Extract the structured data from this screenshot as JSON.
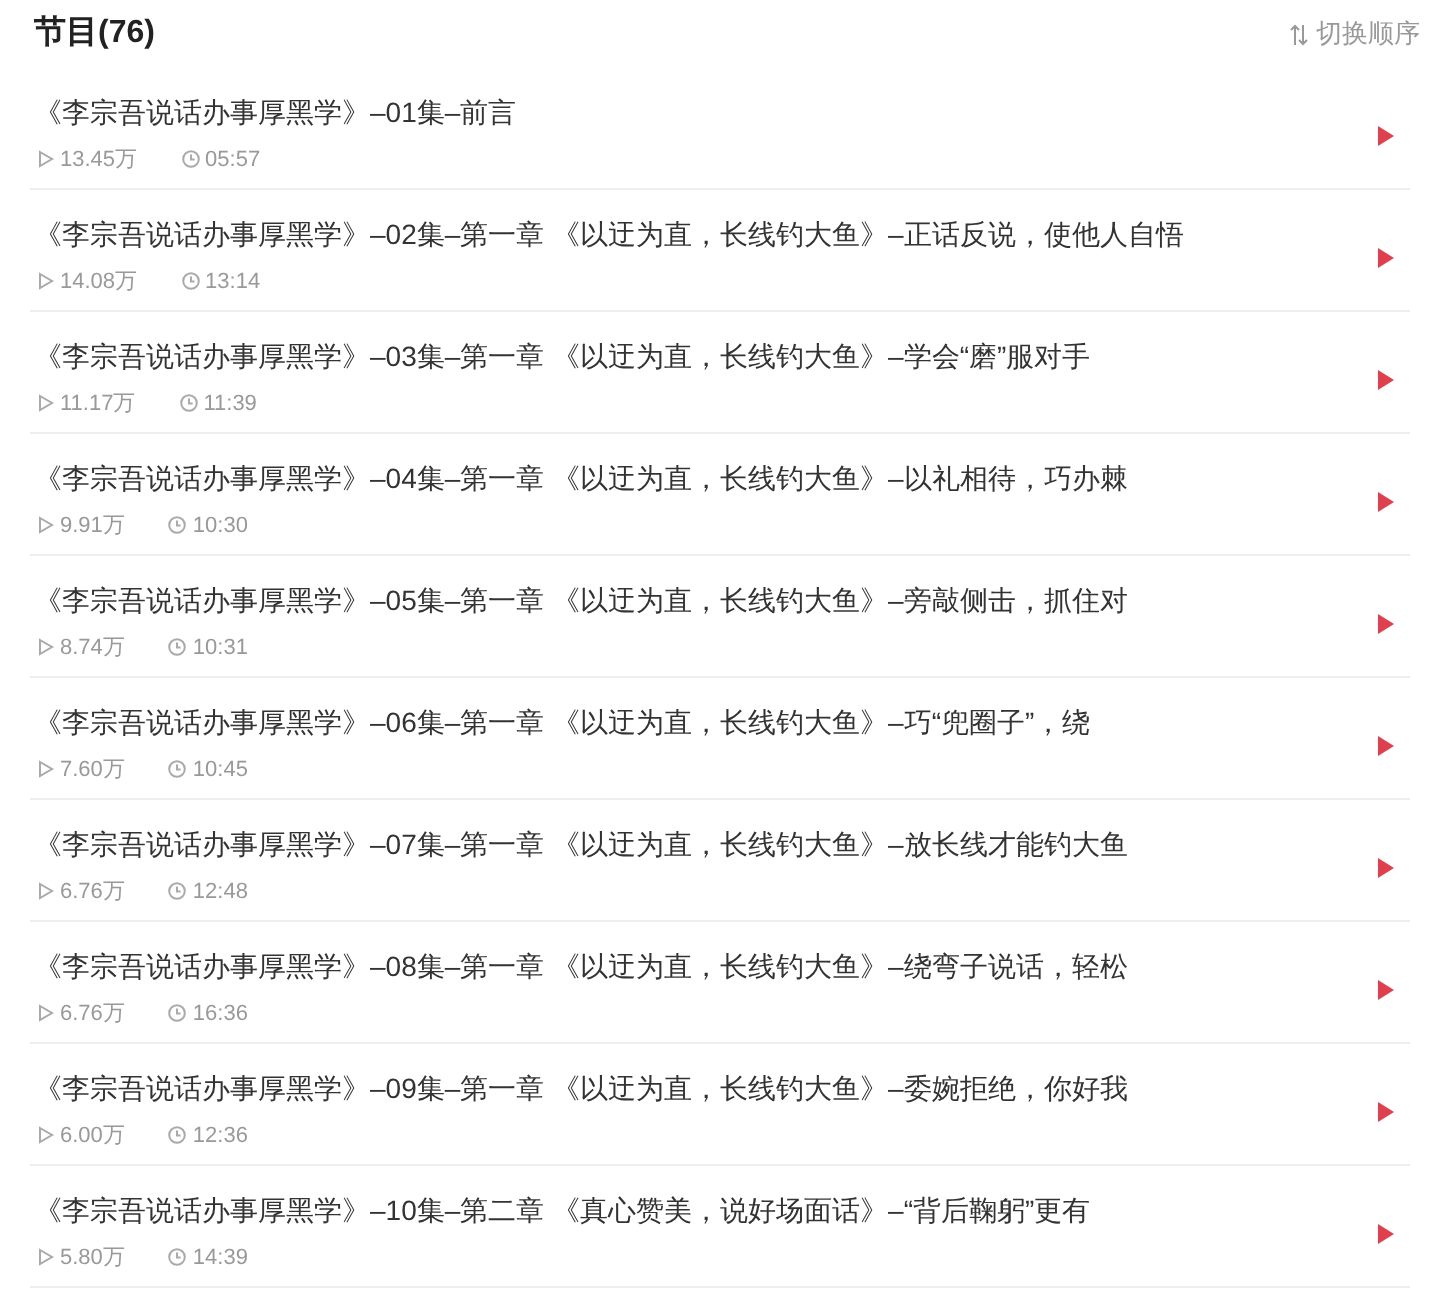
{
  "header": {
    "title": "节目(76)",
    "sort_label": "切换顺序"
  },
  "episodes": [
    {
      "title": "《李宗吾说话办事厚黑学》–01集–前言",
      "plays": "13.45万",
      "duration": "05:57"
    },
    {
      "title": "《李宗吾说话办事厚黑学》–02集–第一章 《以迂为直，长线钓大鱼》–正话反说，使他人自悟",
      "plays": "14.08万",
      "duration": "13:14"
    },
    {
      "title": "《李宗吾说话办事厚黑学》–03集–第一章 《以迂为直，长线钓大鱼》–学会“磨”服对手",
      "plays": "11.17万",
      "duration": "11:39"
    },
    {
      "title": "《李宗吾说话办事厚黑学》–04集–第一章 《以迂为直，长线钓大鱼》–以礼相待，巧办棘",
      "plays": "9.91万",
      "duration": "10:30"
    },
    {
      "title": "《李宗吾说话办事厚黑学》–05集–第一章 《以迂为直，长线钓大鱼》–旁敲侧击，抓住对",
      "plays": "8.74万",
      "duration": "10:31"
    },
    {
      "title": "《李宗吾说话办事厚黑学》–06集–第一章 《以迂为直，长线钓大鱼》–巧“兜圈子”，绕",
      "plays": "7.60万",
      "duration": "10:45"
    },
    {
      "title": "《李宗吾说话办事厚黑学》–07集–第一章 《以迂为直，长线钓大鱼》–放长线才能钓大鱼",
      "plays": "6.76万",
      "duration": "12:48"
    },
    {
      "title": "《李宗吾说话办事厚黑学》–08集–第一章 《以迂为直，长线钓大鱼》–绕弯子说话，轻松",
      "plays": "6.76万",
      "duration": "16:36"
    },
    {
      "title": "《李宗吾说话办事厚黑学》–09集–第一章 《以迂为直，长线钓大鱼》–委婉拒绝，你好我",
      "plays": "6.00万",
      "duration": "12:36"
    },
    {
      "title": "《李宗吾说话办事厚黑学》–10集–第二章 《真心赞美，说好场面话》–“背后鞠躬”更有",
      "plays": "5.80万",
      "duration": "14:39"
    }
  ]
}
